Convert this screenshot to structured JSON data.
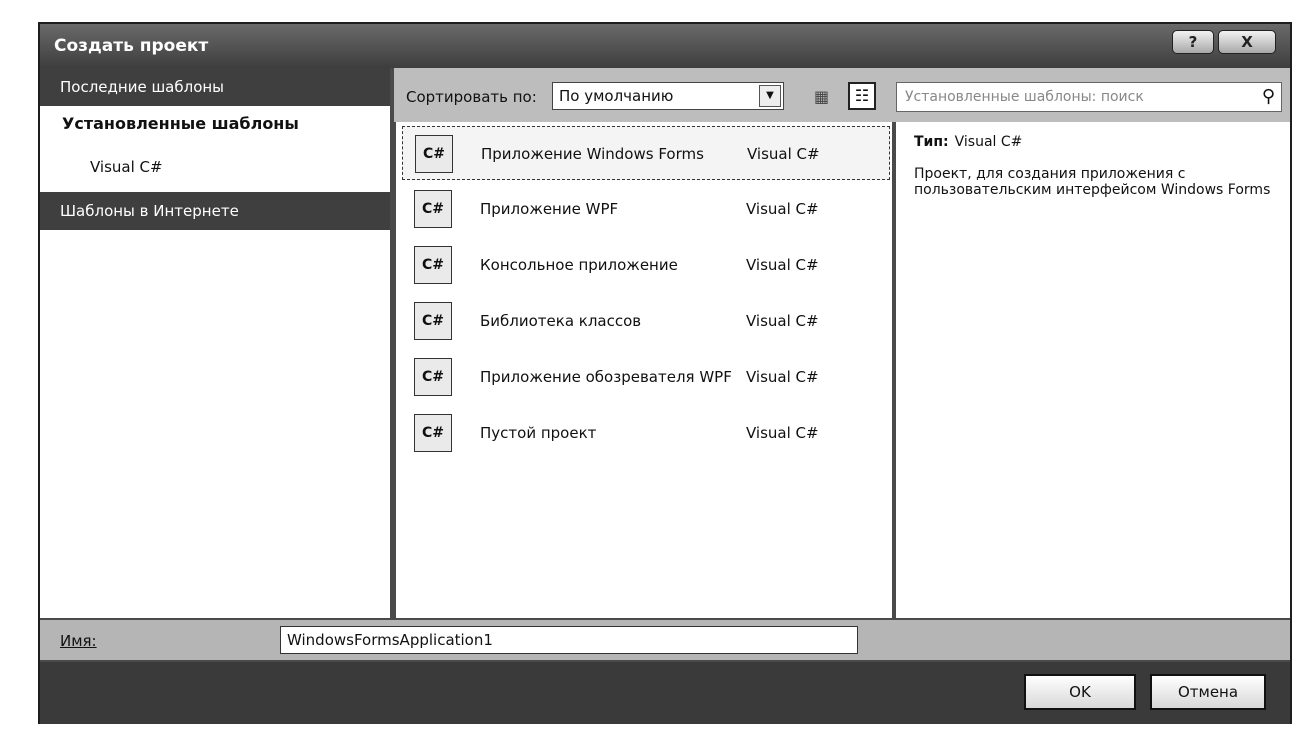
{
  "window": {
    "title": "Создать проект",
    "help_glyph": "?",
    "close_glyph": "X"
  },
  "sidebar": {
    "recent": "Последние шаблоны",
    "installed": "Установленные шаблоны",
    "visual_csharp": "Visual C#",
    "online": "Шаблоны в Интернете"
  },
  "toolbar": {
    "sort_label": "Сортировать по:",
    "sort_value": "По умолчанию",
    "search_placeholder": "Установленные шаблоны: поиск"
  },
  "templates": [
    {
      "name": "Приложение Windows Forms",
      "lang": "Visual C#",
      "icon": "winforms-icon",
      "glyph": "C#"
    },
    {
      "name": "Приложение WPF",
      "lang": "Visual C#",
      "icon": "wpf-icon",
      "glyph": "C#"
    },
    {
      "name": "Консольное приложение",
      "lang": "Visual C#",
      "icon": "console-icon",
      "glyph": "C#"
    },
    {
      "name": "Библиотека классов",
      "lang": "Visual C#",
      "icon": "class-library-icon",
      "glyph": "C#"
    },
    {
      "name": "Приложение обозревателя WPF",
      "lang": "Visual C#",
      "icon": "wpf-browser-icon",
      "glyph": "C#"
    },
    {
      "name": "Пустой проект",
      "lang": "Visual C#",
      "icon": "empty-project-icon",
      "glyph": "C#"
    }
  ],
  "details": {
    "type_label": "Тип:",
    "type_value": "Visual C#",
    "description": "Проект, для создания приложения с пользовательским интерфейсом Windows Forms"
  },
  "name_field": {
    "label": "Имя:",
    "value": "WindowsFormsApplication1"
  },
  "buttons": {
    "ok": "OK",
    "cancel": "Отмена"
  }
}
